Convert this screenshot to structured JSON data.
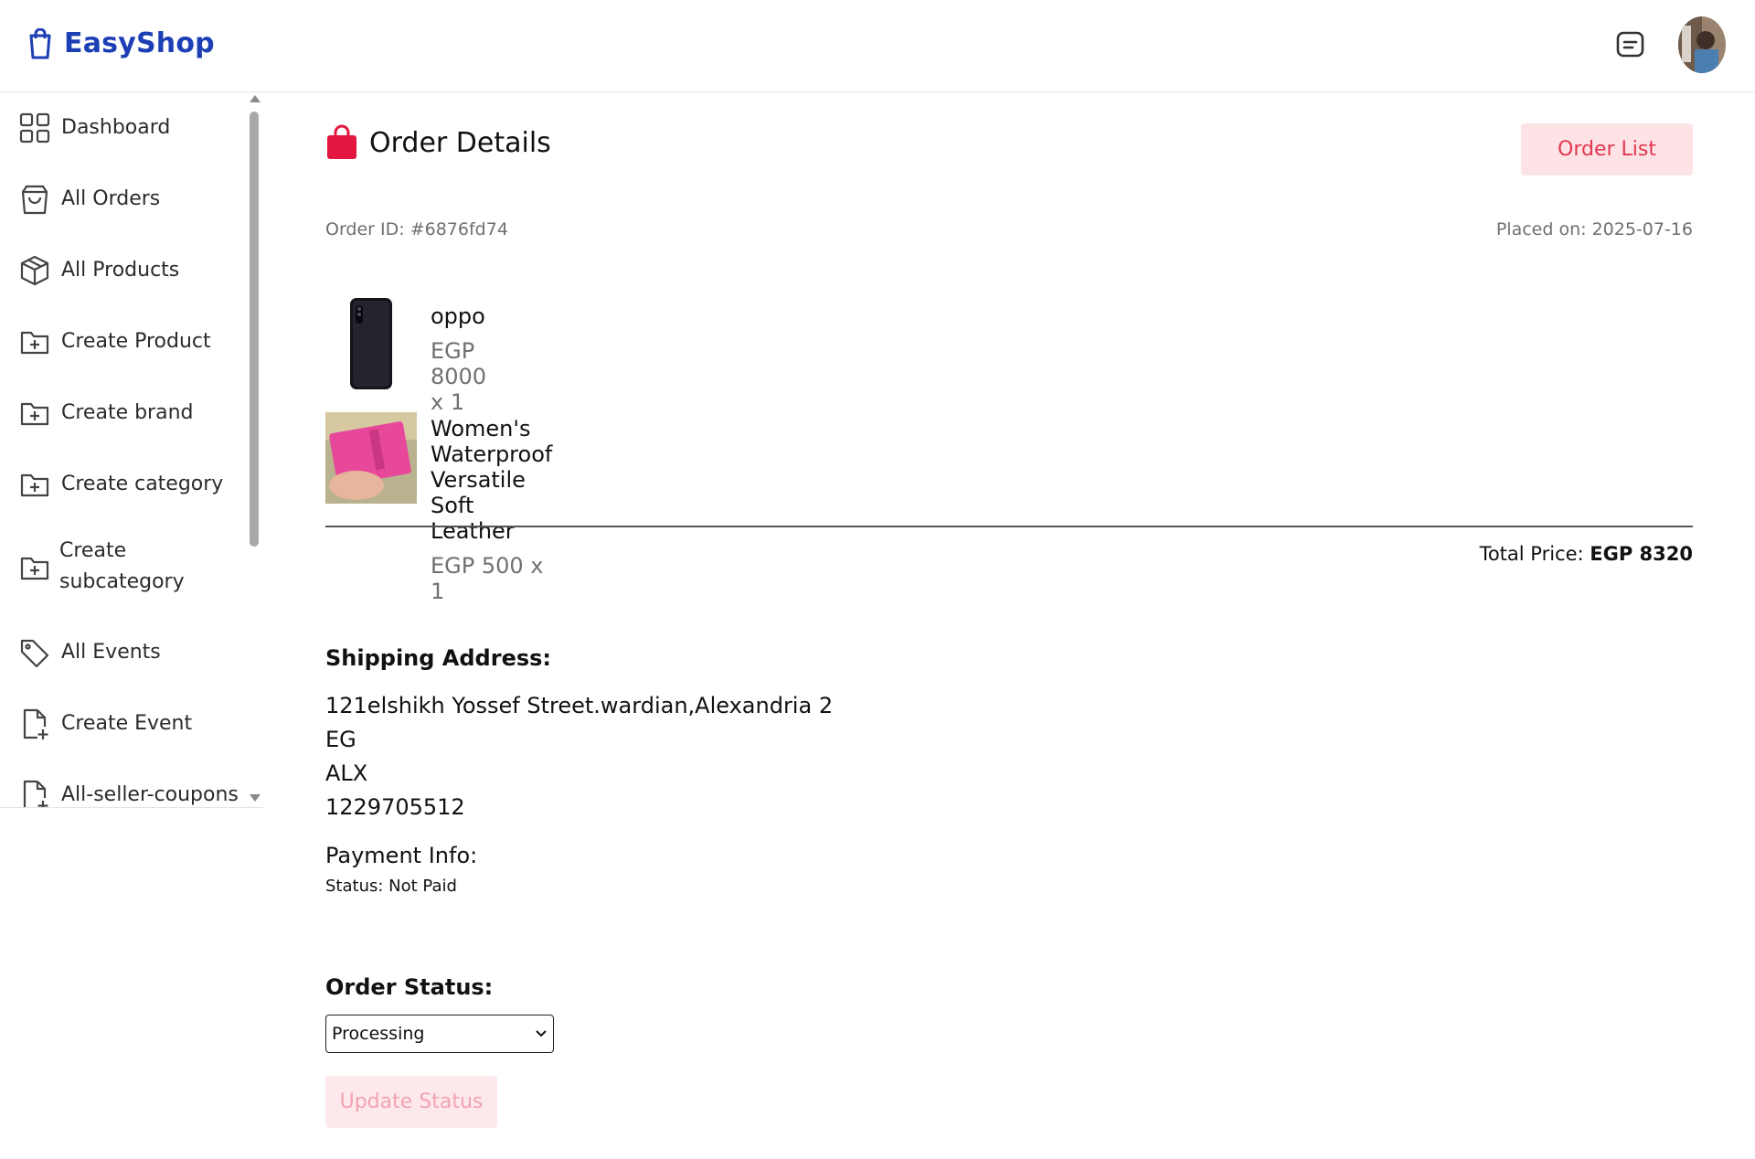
{
  "app": {
    "name": "EasyShop"
  },
  "header": {
    "chat_icon": "message-square-icon",
    "avatar": "user-avatar"
  },
  "sidebar": {
    "items": [
      {
        "label": "Dashboard",
        "icon": "grid-icon"
      },
      {
        "label": "All Orders",
        "icon": "shopping-bag-icon"
      },
      {
        "label": "All Products",
        "icon": "package-icon"
      },
      {
        "label": "Create Product",
        "icon": "folder-plus-icon"
      },
      {
        "label": "Create brand",
        "icon": "folder-plus-icon"
      },
      {
        "label": "Create category",
        "icon": "folder-plus-icon"
      },
      {
        "label": "Create subcategory",
        "line1": "Create",
        "line2": "subcategory",
        "icon": "folder-plus-icon"
      },
      {
        "label": "All Events",
        "icon": "tag-icon"
      },
      {
        "label": "Create Event",
        "icon": "file-plus-icon"
      },
      {
        "label": "All-seller-coupons",
        "icon": "file-plus-icon"
      }
    ]
  },
  "main": {
    "title": "Order Details",
    "order_list_button": "Order List",
    "order_id": "Order ID: #6876fd74",
    "placed_on": "Placed on: 2025-07-16",
    "items": [
      {
        "name": "oppo",
        "price": "EGP 8000 x 1"
      },
      {
        "name": "Women's Waterproof Versatile Soft Leather",
        "price": "EGP 500 x 1"
      }
    ],
    "total_label": "Total Price: ",
    "total_value": "EGP 8320",
    "shipping_heading": "Shipping Address:",
    "address_lines": [
      "121elshikh Yossef Street.wardian,Alexandria 2",
      "EG",
      "ALX",
      "1229705512"
    ],
    "payment_heading": "Payment Info:",
    "payment_status": "Status: Not Paid",
    "order_status_heading": "Order Status:",
    "order_status_selected": "Processing",
    "update_button": "Update Status"
  },
  "colors": {
    "brand": "#1d3fb5",
    "accent": "#e3364f",
    "accent_bg": "#fde2e6"
  }
}
